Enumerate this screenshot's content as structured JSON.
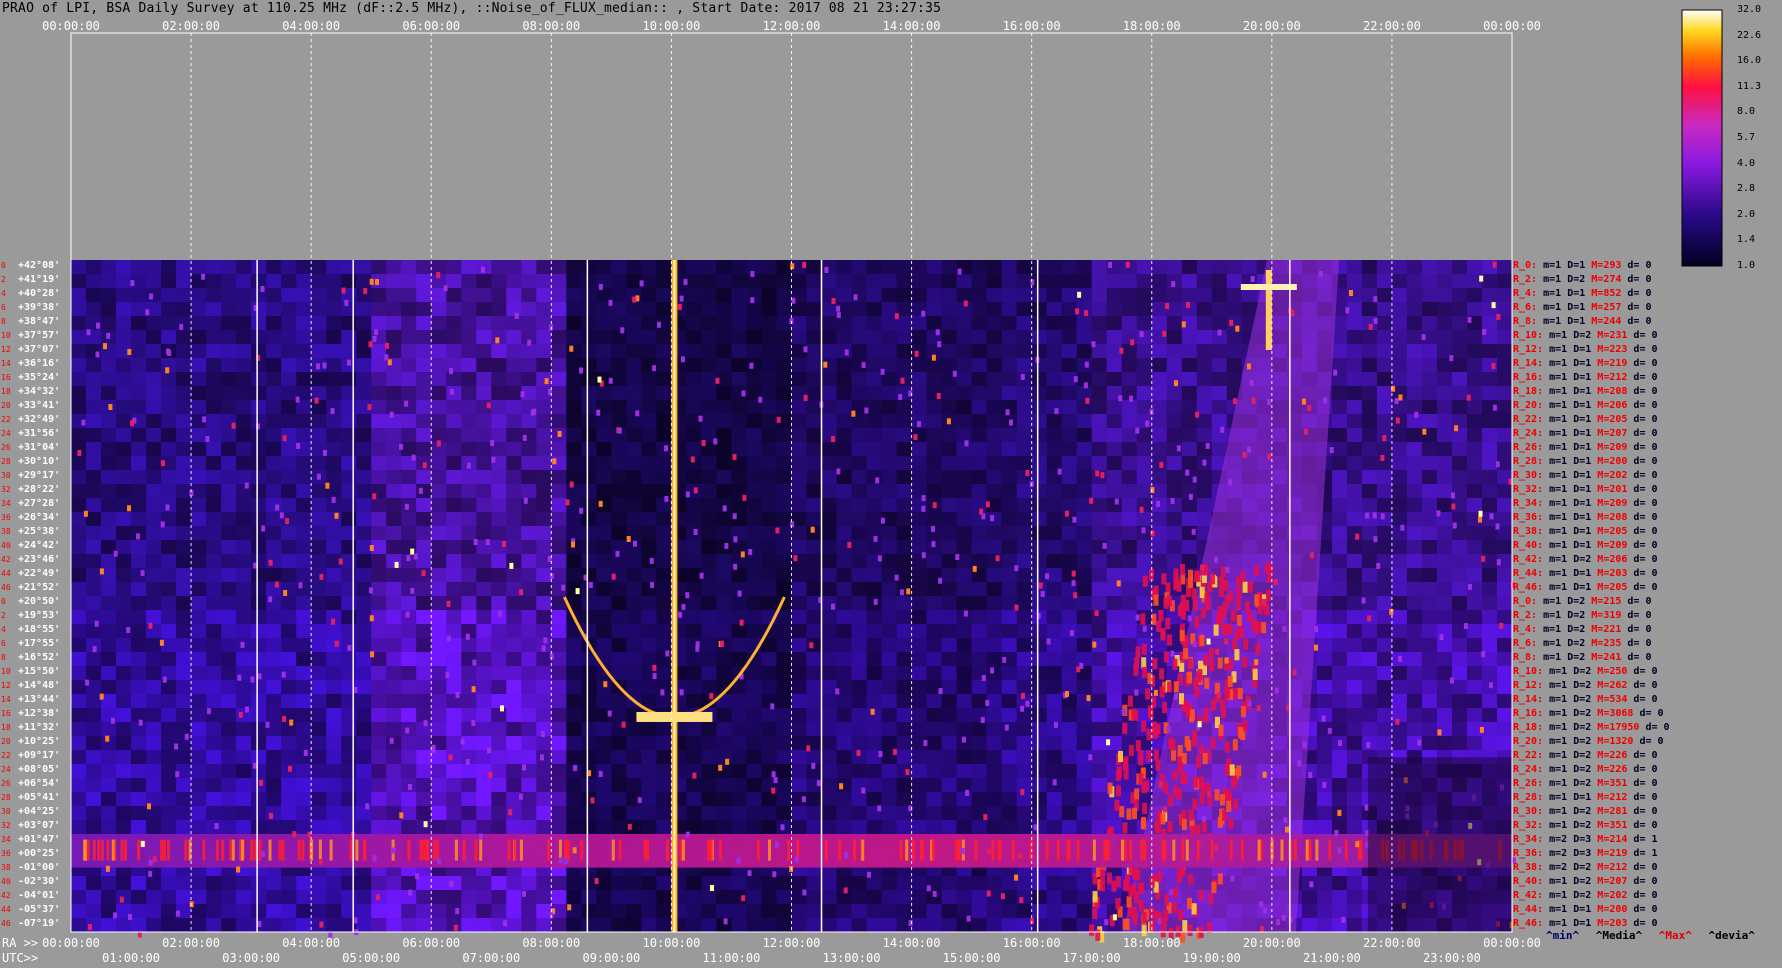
{
  "title": "PRAO of LPI, BSA Daily Survey at 110.25 MHz (dF::2.5 MHz), ::Noise_of_FLUX_median:: , Start Date: 2017 08 21 23:27:35",
  "top_ticks": [
    "00:00:00",
    "02:00:00",
    "04:00:00",
    "06:00:00",
    "08:00:00",
    "10:00:00",
    "12:00:00",
    "14:00:00",
    "16:00:00",
    "18:00:00",
    "20:00:00",
    "22:00:00",
    "00:00:00"
  ],
  "ra_label": "RA >>",
  "ra_ticks": [
    "00:00:00",
    "02:00:00",
    "04:00:00",
    "06:00:00",
    "08:00:00",
    "10:00:00",
    "12:00:00",
    "14:00:00",
    "16:00:00",
    "18:00:00",
    "20:00:00",
    "22:00:00",
    "00:00:00"
  ],
  "utc_label": "UTC>>",
  "utc_ticks": [
    "01:00:00",
    "03:00:00",
    "05:00:00",
    "07:00:00",
    "09:00:00",
    "11:00:00",
    "13:00:00",
    "15:00:00",
    "17:00:00",
    "19:00:00",
    "21:00:00",
    "23:00:00"
  ],
  "declinations": [
    "+42°08'",
    "+41°19'",
    "+40°28'",
    "+39°38'",
    "+38°47'",
    "+37°57'",
    "+37°07'",
    "+36°16'",
    "+35°24'",
    "+34°32'",
    "+33°41'",
    "+32°49'",
    "+31°56'",
    "+31°04'",
    "+30°10'",
    "+29°17'",
    "+28°22'",
    "+27°28'",
    "+26°34'",
    "+25°38'",
    "+24°42'",
    "+23°46'",
    "+22°49'",
    "+21°52'",
    "+20°50'",
    "+19°53'",
    "+18°55'",
    "+17°55'",
    "+16°52'",
    "+15°50'",
    "+14°48'",
    "+13°44'",
    "+12°38'",
    "+11°32'",
    "+10°25'",
    "+09°17'",
    "+08°05'",
    "+06°54'",
    "+05°41'",
    "+04°25'",
    "+03°07'",
    "+01°47'",
    "+00°25'",
    "-01°00'",
    "-02°30'",
    "-04°01'",
    "-05°37'",
    "-07°19'"
  ],
  "row_indices": [
    "0",
    "2",
    "4",
    "6",
    "8",
    "10",
    "12",
    "14",
    "16",
    "18",
    "20",
    "22",
    "24",
    "26",
    "28",
    "30",
    "32",
    "34",
    "36",
    "38",
    "40",
    "42",
    "44",
    "46",
    "0",
    "2",
    "4",
    "6",
    "8",
    "10",
    "12",
    "14",
    "16",
    "18",
    "20",
    "22",
    "24",
    "26",
    "28",
    "30",
    "32",
    "34",
    "36",
    "38",
    "40",
    "42",
    "44",
    "46"
  ],
  "rays": [
    {
      "name": "R_0:",
      "m": "m=1",
      "D": "D=1",
      "M": "M=293",
      "d": "d= 0"
    },
    {
      "name": "R_2:",
      "m": "m=1",
      "D": "D=2",
      "M": "M=274",
      "d": "d= 0"
    },
    {
      "name": "R_4:",
      "m": "m=1",
      "D": "D=1",
      "M": "M=852",
      "d": "d= 0"
    },
    {
      "name": "R_6:",
      "m": "m=1",
      "D": "D=1",
      "M": "M=257",
      "d": "d= 0"
    },
    {
      "name": "R_8:",
      "m": "m=1",
      "D": "D=1",
      "M": "M=244",
      "d": "d= 0"
    },
    {
      "name": "R_10:",
      "m": "m=1",
      "D": "D=2",
      "M": "M=231",
      "d": "d= 0"
    },
    {
      "name": "R_12:",
      "m": "m=1",
      "D": "D=1",
      "M": "M=223",
      "d": "d= 0"
    },
    {
      "name": "R_14:",
      "m": "m=1",
      "D": "D=1",
      "M": "M=219",
      "d": "d= 0"
    },
    {
      "name": "R_16:",
      "m": "m=1",
      "D": "D=1",
      "M": "M=212",
      "d": "d= 0"
    },
    {
      "name": "R_18:",
      "m": "m=1",
      "D": "D=1",
      "M": "M=208",
      "d": "d= 0"
    },
    {
      "name": "R_20:",
      "m": "m=1",
      "D": "D=1",
      "M": "M=206",
      "d": "d= 0"
    },
    {
      "name": "R_22:",
      "m": "m=1",
      "D": "D=1",
      "M": "M=205",
      "d": "d= 0"
    },
    {
      "name": "R_24:",
      "m": "m=1",
      "D": "D=1",
      "M": "M=207",
      "d": "d= 0"
    },
    {
      "name": "R_26:",
      "m": "m=1",
      "D": "D=1",
      "M": "M=209",
      "d": "d= 0"
    },
    {
      "name": "R_28:",
      "m": "m=1",
      "D": "D=1",
      "M": "M=200",
      "d": "d= 0"
    },
    {
      "name": "R_30:",
      "m": "m=1",
      "D": "D=1",
      "M": "M=202",
      "d": "d= 0"
    },
    {
      "name": "R_32:",
      "m": "m=1",
      "D": "D=1",
      "M": "M=201",
      "d": "d= 0"
    },
    {
      "name": "R_34:",
      "m": "m=1",
      "D": "D=1",
      "M": "M=209",
      "d": "d= 0"
    },
    {
      "name": "R_36:",
      "m": "m=1",
      "D": "D=1",
      "M": "M=208",
      "d": "d= 0"
    },
    {
      "name": "R_38:",
      "m": "m=1",
      "D": "D=1",
      "M": "M=205",
      "d": "d= 0"
    },
    {
      "name": "R_40:",
      "m": "m=1",
      "D": "D=1",
      "M": "M=209",
      "d": "d= 0"
    },
    {
      "name": "R_42:",
      "m": "m=1",
      "D": "D=2",
      "M": "M=206",
      "d": "d= 0"
    },
    {
      "name": "R_44:",
      "m": "m=1",
      "D": "D=1",
      "M": "M=203",
      "d": "d= 0"
    },
    {
      "name": "R_46:",
      "m": "m=1",
      "D": "D=1",
      "M": "M=205",
      "d": "d= 0"
    },
    {
      "name": "R_0:",
      "m": "m=1",
      "D": "D=2",
      "M": "M=215",
      "d": "d= 0"
    },
    {
      "name": "R_2:",
      "m": "m=1",
      "D": "D=2",
      "M": "M=319",
      "d": "d= 0"
    },
    {
      "name": "R_4:",
      "m": "m=1",
      "D": "D=2",
      "M": "M=221",
      "d": "d= 0"
    },
    {
      "name": "R_6:",
      "m": "m=1",
      "D": "D=2",
      "M": "M=235",
      "d": "d= 0"
    },
    {
      "name": "R_8:",
      "m": "m=1",
      "D": "D=2",
      "M": "M=241",
      "d": "d= 0"
    },
    {
      "name": "R_10:",
      "m": "m=1",
      "D": "D=2",
      "M": "M=250",
      "d": "d= 0"
    },
    {
      "name": "R_12:",
      "m": "m=1",
      "D": "D=2",
      "M": "M=262",
      "d": "d= 0"
    },
    {
      "name": "R_14:",
      "m": "m=1",
      "D": "D=2",
      "M": "M=534",
      "d": "d= 0"
    },
    {
      "name": "R_16:",
      "m": "m=1",
      "D": "D=2",
      "M": "M=3068",
      "d": "d= 0"
    },
    {
      "name": "R_18:",
      "m": "m=1",
      "D": "D=2",
      "M": "M=17950",
      "d": "d= 0"
    },
    {
      "name": "R_20:",
      "m": "m=1",
      "D": "D=2",
      "M": "M=1320",
      "d": "d= 0"
    },
    {
      "name": "R_22:",
      "m": "m=1",
      "D": "D=2",
      "M": "M=226",
      "d": "d= 0"
    },
    {
      "name": "R_24:",
      "m": "m=1",
      "D": "D=2",
      "M": "M=226",
      "d": "d= 0"
    },
    {
      "name": "R_26:",
      "m": "m=1",
      "D": "D=2",
      "M": "M=351",
      "d": "d= 0"
    },
    {
      "name": "R_28:",
      "m": "m=1",
      "D": "D=1",
      "M": "M=212",
      "d": "d= 0"
    },
    {
      "name": "R_30:",
      "m": "m=1",
      "D": "D=2",
      "M": "M=281",
      "d": "d= 0"
    },
    {
      "name": "R_32:",
      "m": "m=1",
      "D": "D=2",
      "M": "M=351",
      "d": "d= 0"
    },
    {
      "name": "R_34:",
      "m": "m=2",
      "D": "D=3",
      "M": "M=214",
      "d": "d= 1"
    },
    {
      "name": "R_36:",
      "m": "m=2",
      "D": "D=3",
      "M": "M=219",
      "d": "d= 1"
    },
    {
      "name": "R_38:",
      "m": "m=2",
      "D": "D=2",
      "M": "M=212",
      "d": "d= 0"
    },
    {
      "name": "R_40:",
      "m": "m=1",
      "D": "D=2",
      "M": "M=207",
      "d": "d= 0"
    },
    {
      "name": "R_42:",
      "m": "m=1",
      "D": "D=2",
      "M": "M=202",
      "d": "d= 0"
    },
    {
      "name": "R_44:",
      "m": "m=1",
      "D": "D=1",
      "M": "M=200",
      "d": "d= 0"
    },
    {
      "name": "R_46:",
      "m": "m=1",
      "D": "D=1",
      "M": "M=203",
      "d": "d= 0"
    }
  ],
  "colorbar": [
    "32.0",
    "22.6",
    "16.0",
    "11.3",
    "8.0",
    "5.7",
    "4.0",
    "2.8",
    "2.0",
    "1.4",
    "1.0"
  ],
  "legend": {
    "min": "^min^",
    "median": "^Media^",
    "max": "^Max^",
    "dev": "^devia^"
  },
  "colors": {
    "background": "#9a9a9a",
    "name_red": "#e00000",
    "min_navy": "#000066",
    "grid": "#ffffff"
  }
}
